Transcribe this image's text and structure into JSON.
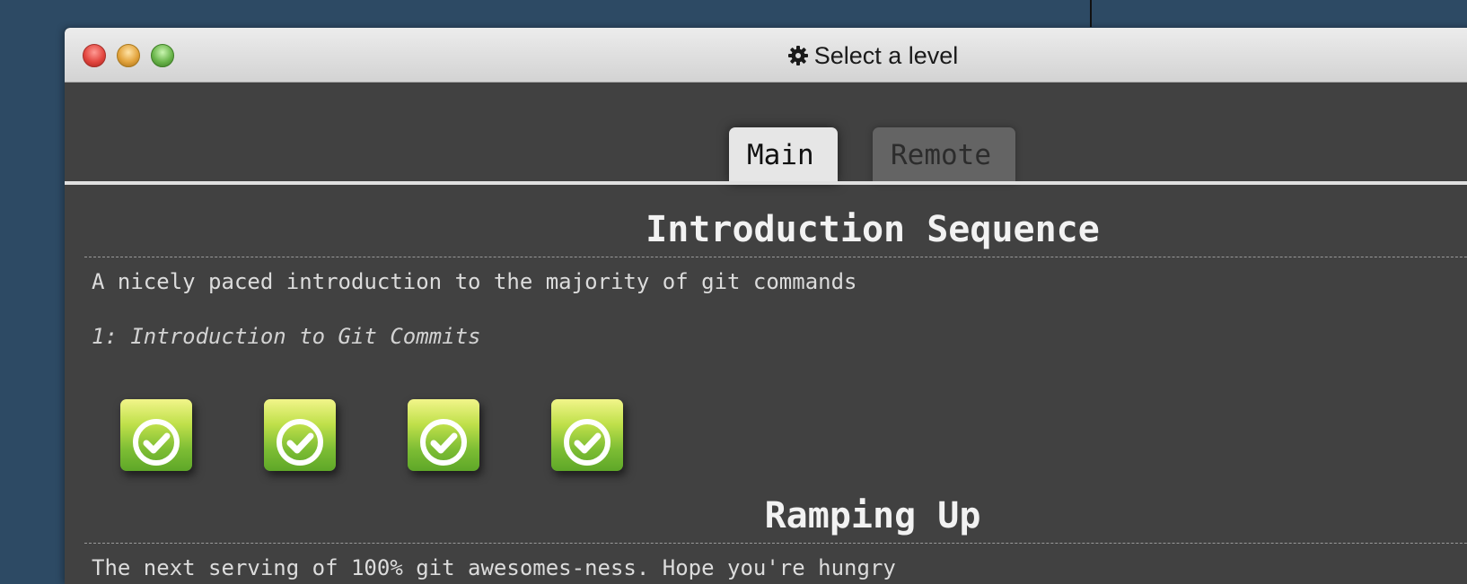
{
  "window": {
    "title": "Select a level",
    "title_icon": "gear-icon",
    "controls": [
      "close",
      "minimize",
      "zoom"
    ]
  },
  "tabs": [
    {
      "label": "Main",
      "active": true
    },
    {
      "label": "Remote",
      "active": false
    }
  ],
  "sequences": [
    {
      "title": "Introduction Sequence",
      "description": "A nicely paced introduction to the majority of git commands",
      "level_title": "1: Introduction to Git Commits",
      "levels": [
        {
          "icon": "checkmark-icon",
          "completed": true
        },
        {
          "icon": "checkmark-icon",
          "completed": true
        },
        {
          "icon": "checkmark-icon",
          "completed": true
        },
        {
          "icon": "checkmark-icon",
          "completed": true
        }
      ]
    },
    {
      "title": "Ramping Up",
      "description": "The next serving of 100% git awesomes-ness. Hope you're hungry"
    }
  ],
  "colors": {
    "desktop": "#2d4a64",
    "window_bg": "#414141",
    "level_complete": "#7dbd34"
  }
}
